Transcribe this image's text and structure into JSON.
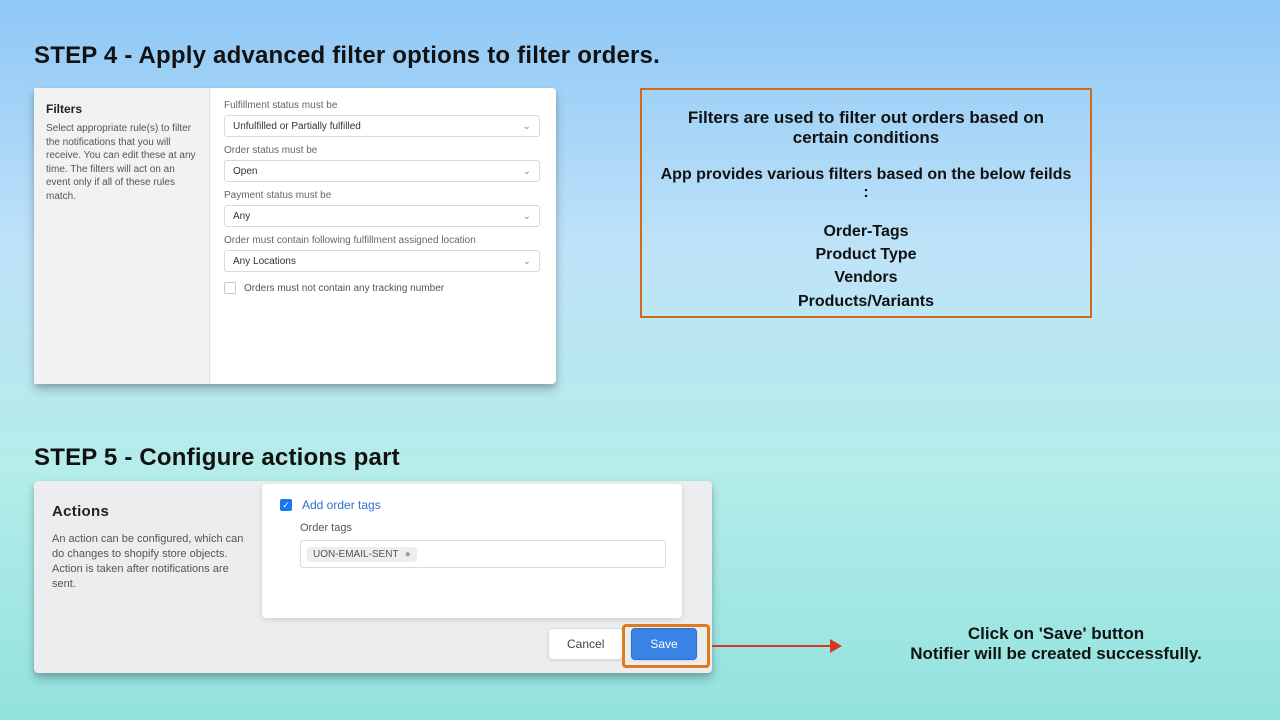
{
  "step4": {
    "title": "STEP 4 - Apply advanced filter options to filter orders.",
    "filters_title": "Filters",
    "filters_desc": "Select appropriate rule(s) to filter the notifications that you will receive. You can edit these at any time. The filters will act on an event only if all of these rules match.",
    "fields": {
      "fulfillment_label": "Fulfillment status must be",
      "fulfillment_value": "Unfulfilled or Partially fulfilled",
      "order_status_label": "Order status must be",
      "order_status_value": "Open",
      "payment_status_label": "Payment status must be",
      "payment_status_value": "Any",
      "location_label": "Order must contain following fulfillment assigned location",
      "location_value": "Any Locations",
      "tracking_checkbox": "Orders must not contain any tracking number"
    },
    "info": {
      "line1": "Filters are used to filter out orders based on",
      "line2": "certain conditions",
      "line3": "App provides various filters based on the below feilds :",
      "items": [
        "Order-Tags",
        "Product Type",
        "Vendors",
        "Products/Variants"
      ]
    }
  },
  "step5": {
    "title": "STEP 5 - Configure actions part",
    "actions_title": "Actions",
    "actions_desc": "An action can be configured, which can do changes to shopify store objects. Action is taken after notifications are sent.",
    "add_order_tags": "Add order tags",
    "order_tags_label": "Order tags",
    "tag_value": "UON-EMAIL-SENT",
    "cancel": "Cancel",
    "save": "Save",
    "callout1": "Click on 'Save' button",
    "callout2": "Notifier will be created successfully."
  }
}
